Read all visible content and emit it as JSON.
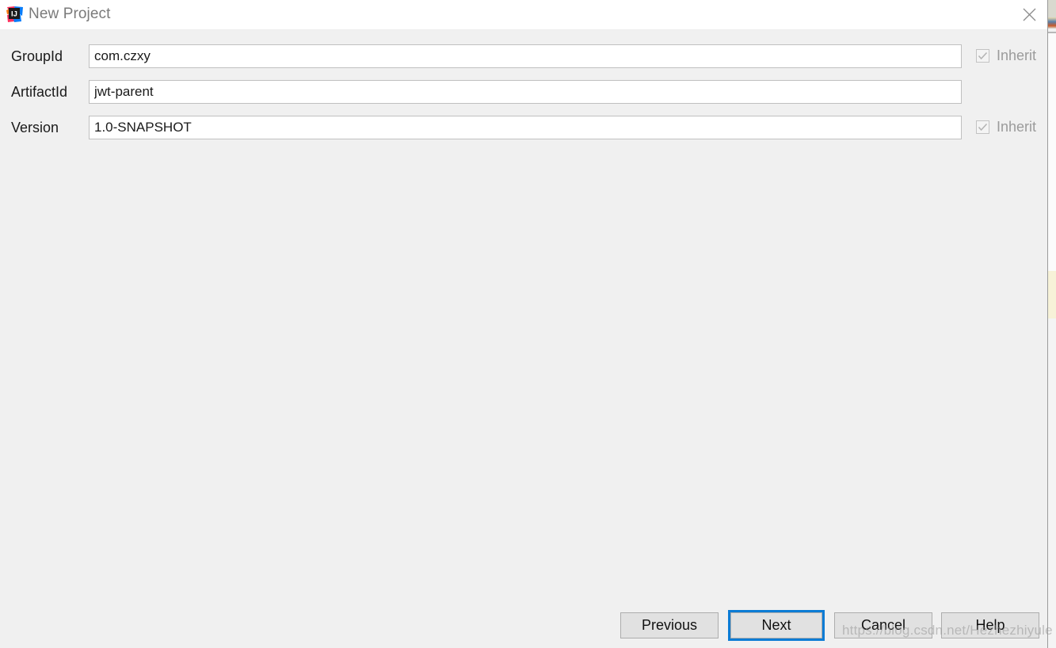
{
  "window": {
    "title": "New Project",
    "logo_icon": "intellij-idea-logo",
    "close_icon": "close-icon"
  },
  "form": {
    "fields": [
      {
        "label": "GroupId",
        "value": "com.czxy",
        "placeholder": "",
        "inherit": {
          "label": "Inherit",
          "checked": true,
          "enabled": false
        }
      },
      {
        "label": "ArtifactId",
        "value": "jwt-parent",
        "placeholder": "",
        "inherit": null
      },
      {
        "label": "Version",
        "value": "1.0-SNAPSHOT",
        "placeholder": "",
        "inherit": {
          "label": "Inherit",
          "checked": true,
          "enabled": false
        }
      }
    ]
  },
  "buttons": {
    "previous": "Previous",
    "next": "Next",
    "cancel": "Cancel",
    "help": "Help"
  },
  "colors": {
    "focus_ring": "#0c7cd5",
    "dialog_background": "#f0f0f0",
    "titlebar_background": "#ffffff",
    "button_face": "#e1e1e1",
    "disabled_text": "#9b9b9b"
  },
  "watermark": {
    "text": "https://blog.csdn.net/Hezhezhiyule"
  }
}
